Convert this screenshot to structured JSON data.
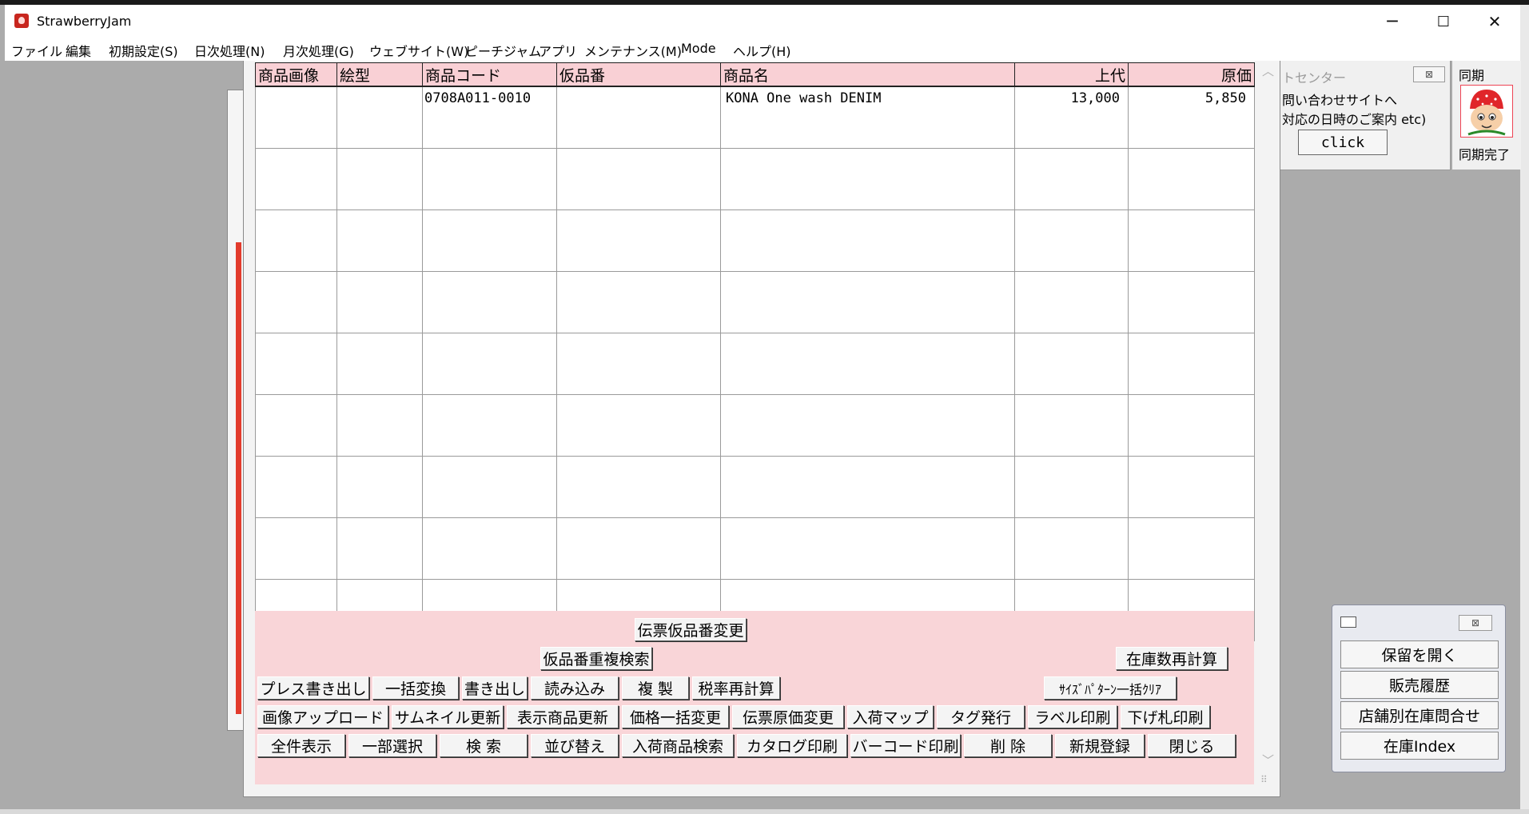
{
  "window": {
    "title": "StrawberryJam",
    "minimize": "─",
    "maximize": "☐",
    "close": "✕"
  },
  "menu": {
    "items": [
      "ファイル",
      "編集",
      "初期設定(S)",
      "日次処理(N)",
      "月次処理(G)",
      "ウェブサイト(W)",
      "ピーチジャム",
      "アプリ",
      "メンテナンス(M)",
      "Mode",
      "ヘルプ(H)"
    ]
  },
  "table": {
    "headers": [
      "商品画像",
      "絵型",
      "商品コード",
      "仮品番",
      "商品名",
      "上代",
      "原価"
    ],
    "rows": [
      {
        "image": "",
        "pattern": "",
        "code": "0708A011-0010",
        "temp_no": "",
        "name": "KONA One wash DENIM",
        "retail": "13,000",
        "cost": "5,850"
      }
    ]
  },
  "scroll": {
    "up": "︿",
    "down": "﹀",
    "left": "<",
    "right": ">",
    "grip": "⠿"
  },
  "buttons": {
    "denpyo_kari_henko": "伝票仮品番変更",
    "karihin_chofuku": "仮品番重複検索",
    "zaiko_saikeisan": "在庫数再計算",
    "press_kakidashi": "プレス書き出し",
    "ikkatsu_henkan": "一括変換",
    "kakidashi": "書き出し",
    "yomikomi": "読み込み",
    "fukusei": "複 製",
    "zeiritsu": "税率再計算",
    "size_pattern_clear": "ｻｲｽﾞﾊﾟﾀｰﾝ一括ｸﾘｱ",
    "image_upload": "画像アップロード",
    "thumbnail": "サムネイル更新",
    "hyoji_koshin": "表示商品更新",
    "kakaku_ikkatsu": "価格一括変更",
    "denpyo_genka": "伝票原価変更",
    "nyuka_map": "入荷マップ",
    "tag_hakko": "タグ発行",
    "label_insatsu": "ラベル印刷",
    "sagefuda": "下げ札印刷",
    "zenken": "全件表示",
    "ichibu": "一部選択",
    "kensaku": "検 索",
    "narabikae": "並び替え",
    "nyuka_kensaku": "入荷商品検索",
    "catalog": "カタログ印刷",
    "barcode": "バーコード印刷",
    "sakujo": "削 除",
    "shinki": "新規登録",
    "tojiru": "閉じる"
  },
  "support_panel": {
    "title": "トセンター",
    "close": "⊠",
    "line1": "問い合わせサイトへ",
    "line2": "対応の日時のご案内 etc)",
    "click_label": "click"
  },
  "sync_panel": {
    "title": "同期",
    "status": "同期完了"
  },
  "mini_panel": {
    "close": "⊠",
    "buttons": [
      "保留を開く",
      "販売履歴",
      "店舗別在庫問合せ",
      "在庫Index"
    ]
  },
  "colors": {
    "header_pink": "#f9d0d5",
    "panel_pink": "#f9d5d8",
    "brand_red": "#e23b2c"
  }
}
